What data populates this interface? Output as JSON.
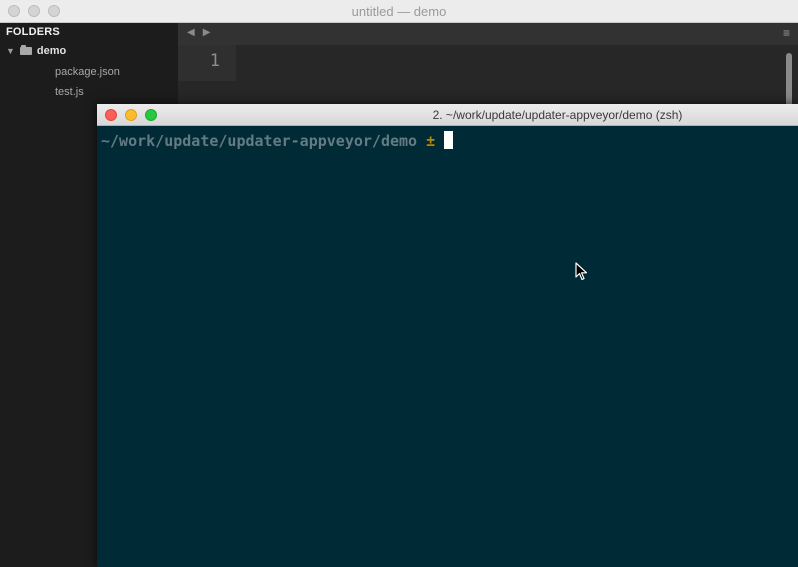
{
  "editor": {
    "window_title": "untitled — demo",
    "sidebar": {
      "heading": "FOLDERS",
      "folder": {
        "name": "demo",
        "expanded": true
      },
      "files": [
        "package.json",
        "test.js"
      ]
    },
    "nav": {
      "back_icon": "◀",
      "forward_icon": "▶"
    },
    "menu_icon": "≡",
    "line_numbers": [
      "1"
    ]
  },
  "terminal": {
    "window_title": "2. ~/work/update/updater-appveyor/demo (zsh)",
    "prompt_path": "~/work/update/updater-appveyor/demo",
    "prompt_symbol": "±",
    "background": "#002b36",
    "prompt_color": "#657b83",
    "symbol_color": "#b58900"
  }
}
